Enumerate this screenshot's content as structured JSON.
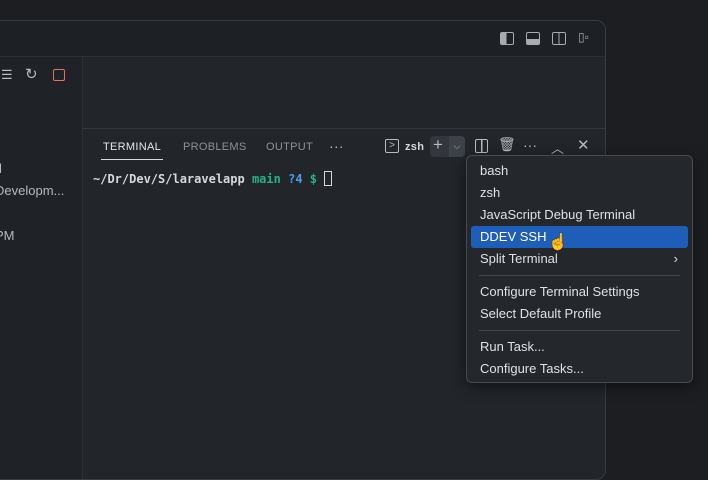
{
  "sidebar": {
    "fragments": [
      "l",
      "Developm...",
      "PM"
    ]
  },
  "panel": {
    "tabs": [
      {
        "label": "TERMINAL",
        "active": true
      },
      {
        "label": "PROBLEMS"
      },
      {
        "label": "OUTPUT"
      }
    ],
    "more": "···",
    "shell_name": "zsh"
  },
  "terminal": {
    "path": "~/Dr/Dev/S/laravelapp",
    "branch": "main",
    "status": "?4",
    "symbol": "$"
  },
  "menu": {
    "items": [
      "bash",
      "zsh",
      "JavaScript Debug Terminal",
      "DDEV SSH",
      "Split Terminal",
      "Configure Terminal Settings",
      "Select Default Profile",
      "Run Task...",
      "Configure Tasks..."
    ],
    "selected": "DDEV SSH"
  },
  "colors": {
    "accent": "#1f5eb8",
    "branch": "#23b381",
    "status": "#4a9fe0",
    "stop": "#e8705a"
  }
}
